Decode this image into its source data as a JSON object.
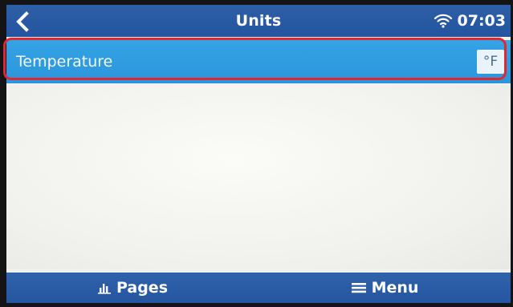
{
  "header": {
    "back_icon": "chevron-left-icon",
    "title": "Units",
    "wifi_icon": "wifi-icon",
    "time": "07:03"
  },
  "settings": [
    {
      "label": "Temperature",
      "value": "°F"
    }
  ],
  "footer": {
    "pages_icon": "bar-chart-icon",
    "pages_label": "Pages",
    "menu_icon": "menu-icon",
    "menu_label": "Menu"
  },
  "colors": {
    "bar": "#2656a0",
    "row": "#2b95db",
    "highlight": "#e3262f",
    "background": "#f1f1ee"
  }
}
